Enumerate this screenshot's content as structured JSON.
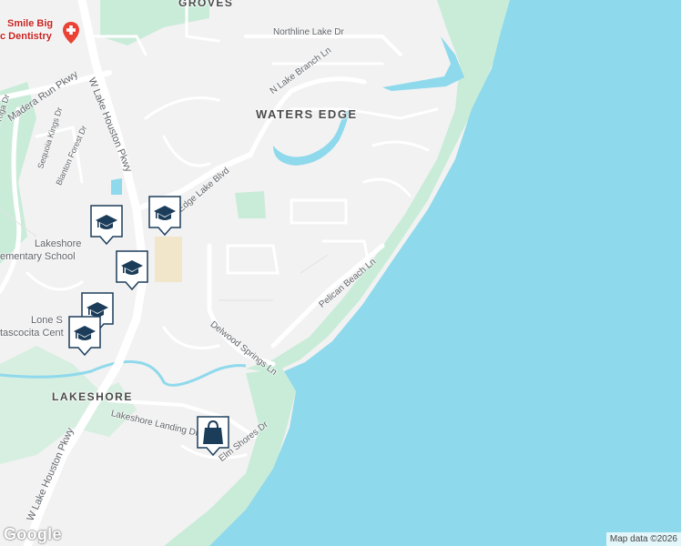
{
  "map": {
    "labels": {
      "groves": "GROVES",
      "waters_edge": "WATERS EDGE",
      "lakeshore_area": "LAKESHORE",
      "northline_lake": "Northline Lake Dr",
      "n_lake_branch": "N Lake Branch Ln",
      "edge_lake": "Edge Lake Blvd",
      "pelican_beach": "Pelican Beach Ln",
      "delwood_springs": "Delwood Springs Ln",
      "lakeshore_landing": "Lakeshore Landing Dr",
      "elm_shores": "Elm Shores Dr",
      "w_lake_houston_top": "W Lake Houston Pkwy",
      "w_lake_houston_bottom": "W Lake Houston Pkwy",
      "madera_run": "Madera Run Pkwy",
      "riga": "ff Riga Dr",
      "sequoia": "Sequoia Kings Dr",
      "blanton": "Blanton Forest Dr",
      "school_1": "Lakeshore",
      "school_2": "ementary School",
      "lone_star": "Lone S",
      "atascocita": "tascocita Cent",
      "dentistry_1": "Smile Big",
      "dentistry_2": "c Dentistry"
    },
    "pins": {
      "school": "school-icon",
      "shopping": "shopping-bag-icon",
      "medical": "medical-cross-icon"
    },
    "colors": {
      "water": "#8fd9ec",
      "park": "#c9ecd9",
      "road": "#ffffff",
      "land": "#f2f2f2",
      "pin_fill": "#1c3d5a"
    },
    "attribution": "Map data ©2026",
    "logo": "Google"
  }
}
